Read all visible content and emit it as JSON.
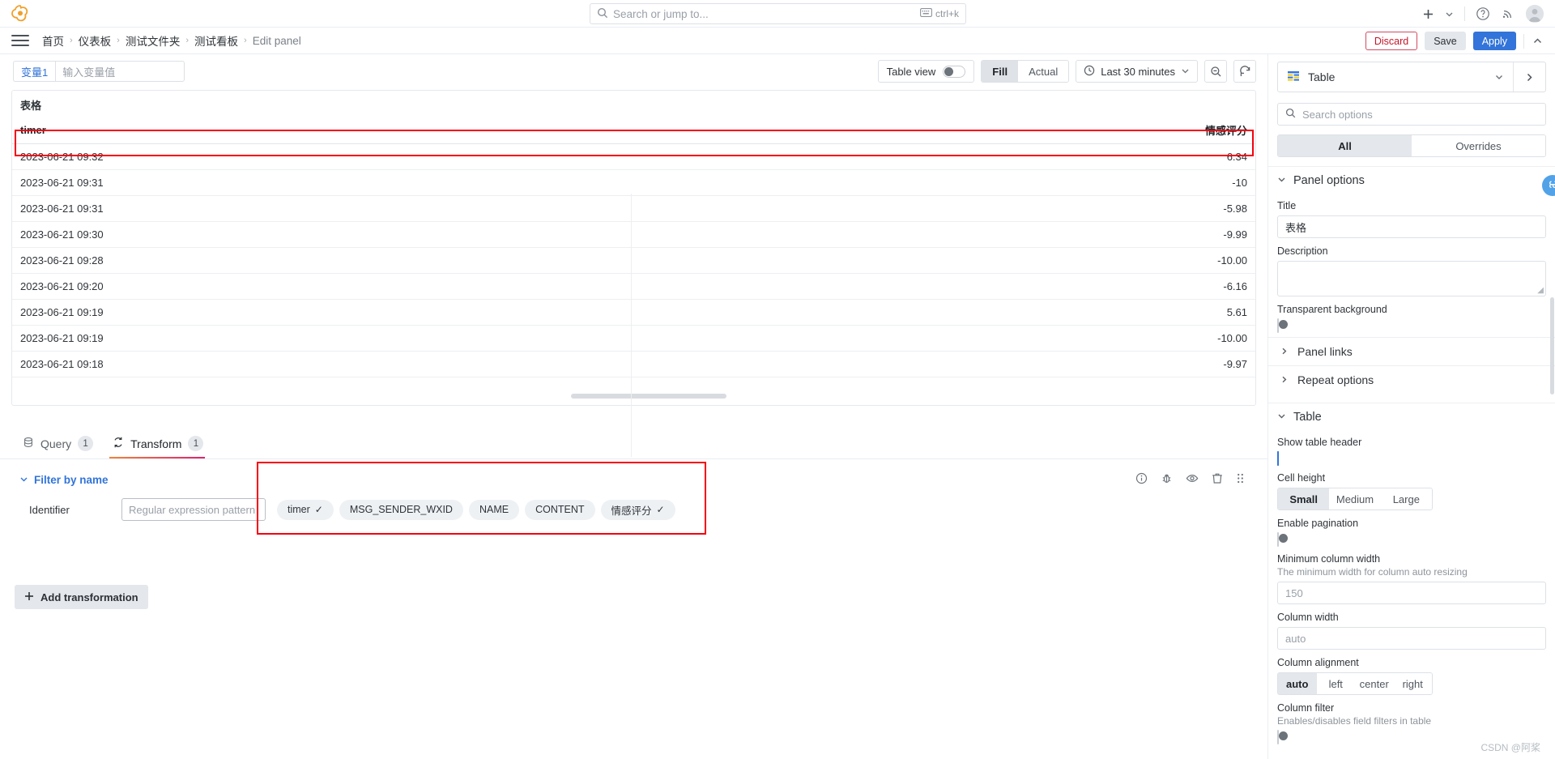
{
  "topnav": {
    "logo_icon": "grafana-logo-icon",
    "search": {
      "placeholder": "Search or jump to...",
      "icon": "search-icon",
      "shortcut": "ctrl+k",
      "shortcut_icon": "keyboard-icon"
    },
    "add_label": "+",
    "add_chevron_icon": "chevron-down-icon",
    "help_icon": "help-circle-icon",
    "news_icon": "rss-icon",
    "avatar_icon": "user-avatar-icon"
  },
  "breadcrumb": {
    "menu_icon": "hamburger-menu-icon",
    "items": [
      {
        "label": "首页"
      },
      {
        "label": "仪表板"
      },
      {
        "label": "测试文件夹"
      },
      {
        "label": "测试看板"
      },
      {
        "label": "Edit panel"
      }
    ],
    "separator": "›"
  },
  "edit_actions": {
    "discard_label": "Discard",
    "save_label": "Save",
    "apply_label": "Apply",
    "collapse_icon": "chevron-up-icon",
    "discard_color": "#c4162a",
    "apply_color": "#3274d9"
  },
  "variables": [
    {
      "label": "变量1",
      "value": "",
      "placeholder": "输入变量值"
    }
  ],
  "panel_toolbar": {
    "table_view_label": "Table view",
    "table_view_on": false,
    "fill_label": "Fill",
    "actual_label": "Actual",
    "fill_selected": true,
    "time_range": "Last 30 minutes",
    "clock_icon": "clock-icon",
    "time_chevron_icon": "chevron-down-icon",
    "zoom_out_icon": "zoom-out-icon",
    "refresh_icon": "refresh-icon"
  },
  "panel": {
    "title": "表格",
    "table": {
      "columns": [
        {
          "key": "timer",
          "label": "timer",
          "align": "left"
        },
        {
          "key": "score",
          "label": "情感评分",
          "align": "right"
        }
      ],
      "rows": [
        {
          "timer": "2023-06-21 09:32",
          "score": "6.34"
        },
        {
          "timer": "2023-06-21 09:31",
          "score": "-10"
        },
        {
          "timer": "2023-06-21 09:31",
          "score": "-5.98"
        },
        {
          "timer": "2023-06-21 09:30",
          "score": "-9.99"
        },
        {
          "timer": "2023-06-21 09:28",
          "score": "-10.00"
        },
        {
          "timer": "2023-06-21 09:20",
          "score": "-6.16"
        },
        {
          "timer": "2023-06-21 09:19",
          "score": "5.61"
        },
        {
          "timer": "2023-06-21 09:19",
          "score": "-10.00"
        },
        {
          "timer": "2023-06-21 09:18",
          "score": "-9.97"
        }
      ]
    }
  },
  "tabs": [
    {
      "id": "query",
      "label": "Query",
      "badge": "1",
      "icon": "database-icon",
      "active": false
    },
    {
      "id": "transform",
      "label": "Transform",
      "badge": "1",
      "icon": "transform-icon",
      "active": true
    }
  ],
  "transform": {
    "title": "Filter by name",
    "collapse_icon": "chevron-down-icon",
    "identifier_label": "Identifier",
    "regex_placeholder": "Regular expression pattern",
    "regex_value": "",
    "fields": [
      {
        "label": "timer",
        "selected": true
      },
      {
        "label": "MSG_SENDER_WXID",
        "selected": false
      },
      {
        "label": "NAME",
        "selected": false
      },
      {
        "label": "CONTENT",
        "selected": false
      },
      {
        "label": "情感评分",
        "selected": true
      }
    ],
    "row_icons": [
      "info-icon",
      "bug-icon",
      "eye-icon",
      "trash-icon",
      "drag-handle-icon"
    ],
    "add_label": "Add transformation",
    "add_icon": "plus-icon"
  },
  "options_pane": {
    "viz_name": "Table",
    "viz_icon": "table-icon",
    "viz_chevron_icon": "chevron-down-icon",
    "viz_next_icon": "chevron-right-icon",
    "search": {
      "placeholder": "Search options",
      "icon": "search-icon"
    },
    "tabs": {
      "all_label": "All",
      "overrides_label": "Overrides",
      "selected": "All"
    },
    "panel_options": {
      "section_label": "Panel options",
      "title_label": "Title",
      "title_value": "表格",
      "description_label": "Description",
      "description_value": "",
      "transparent_label": "Transparent background",
      "transparent_on": false,
      "panel_links_label": "Panel links",
      "repeat_options_label": "Repeat options"
    },
    "table_options": {
      "section_label": "Table",
      "show_header_label": "Show table header",
      "show_header_on": true,
      "cell_height_label": "Cell height",
      "cell_height_options": [
        "Small",
        "Medium",
        "Large"
      ],
      "cell_height_selected": "Small",
      "pagination_label": "Enable pagination",
      "pagination_on": false,
      "min_col_width_label": "Minimum column width",
      "min_col_width_desc": "The minimum width for column auto resizing",
      "min_col_width_placeholder": "150",
      "col_width_label": "Column width",
      "col_width_placeholder": "auto",
      "col_align_label": "Column alignment",
      "col_align_options": [
        "auto",
        "left",
        "center",
        "right"
      ],
      "col_align_selected": "auto",
      "col_filter_label": "Column filter",
      "col_filter_desc": "Enables/disables field filters in table",
      "col_filter_on": false
    }
  },
  "badge_overlay": {
    "icon": "command-badge-icon"
  },
  "watermark": "CSDN @阿桨"
}
